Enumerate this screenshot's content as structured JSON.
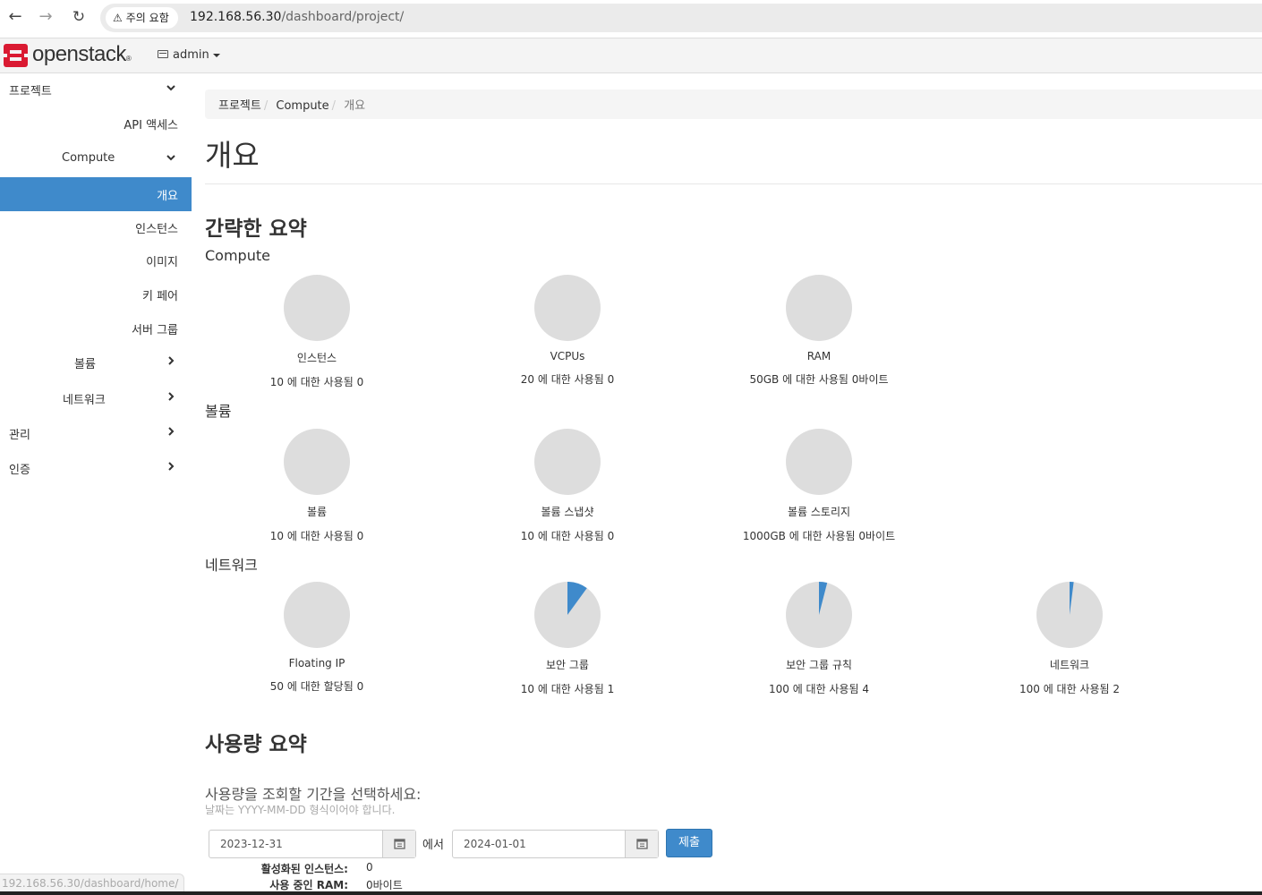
{
  "browser": {
    "security_label": "주의 요함",
    "url_host": "192.168.56.30",
    "url_path": "/dashboard/project/",
    "status_url": "192.168.56.30/dashboard/home/"
  },
  "header": {
    "brand": "openstack",
    "brand_mark": "®",
    "project": "admin"
  },
  "sidebar": {
    "items": [
      {
        "label": "프로젝트",
        "chevron": "down"
      },
      {
        "label": "API 액세스"
      },
      {
        "label": "Compute",
        "chevron": "down"
      },
      {
        "label": "개요",
        "active": true
      },
      {
        "label": "인스턴스"
      },
      {
        "label": "이미지"
      },
      {
        "label": "키 페어"
      },
      {
        "label": "서버 그룹"
      },
      {
        "label": "볼륨",
        "chevron": "right"
      },
      {
        "label": "네트워크",
        "chevron": "right"
      },
      {
        "label": "관리",
        "chevron": "right"
      },
      {
        "label": "인증",
        "chevron": "right"
      }
    ]
  },
  "breadcrumb": [
    "프로젝트",
    "Compute",
    "개요"
  ],
  "page_title": "개요",
  "overview": {
    "heading": "간략한 요약",
    "groups": [
      {
        "label": "Compute",
        "charts": [
          {
            "title": "인스턴스",
            "subtitle": "10 에 대한 사용됨 0",
            "used": 0,
            "total": 10
          },
          {
            "title": "VCPUs",
            "subtitle": "20 에 대한 사용됨 0",
            "used": 0,
            "total": 20
          },
          {
            "title": "RAM",
            "subtitle": "50GB 에 대한 사용됨 0바이트",
            "used": 0,
            "total": 50
          }
        ]
      },
      {
        "label": "볼륨",
        "charts": [
          {
            "title": "볼륨",
            "subtitle": "10 에 대한 사용됨 0",
            "used": 0,
            "total": 10
          },
          {
            "title": "볼륨 스냅샷",
            "subtitle": "10 에 대한 사용됨 0",
            "used": 0,
            "total": 10
          },
          {
            "title": "볼륨 스토리지",
            "subtitle": "1000GB 에 대한 사용됨 0바이트",
            "used": 0,
            "total": 1000
          }
        ]
      },
      {
        "label": "네트워크",
        "charts": [
          {
            "title": "Floating IP",
            "subtitle": "50 에 대한 할당됨 0",
            "used": 0,
            "total": 50
          },
          {
            "title": "보안 그룹",
            "subtitle": "10 에 대한 사용됨 1",
            "used": 1,
            "total": 10
          },
          {
            "title": "보안 그룹 규칙",
            "subtitle": "100 에 대한 사용됨 4",
            "used": 4,
            "total": 100
          },
          {
            "title": "네트워크",
            "subtitle": "100 에 대한 사용됨 2",
            "used": 2,
            "total": 100
          }
        ]
      }
    ]
  },
  "usage": {
    "heading": "사용량 요약",
    "prompt": "사용량을 조회할 기간을 선택하세요:",
    "hint": "날짜는 YYYY-MM-DD 형식이어야 합니다.",
    "start_date": "2023-12-31",
    "from_label": "에서",
    "end_date": "2024-01-01",
    "submit": "제출",
    "summary": [
      {
        "label": "활성화된 인스턴스:",
        "value": "0"
      },
      {
        "label": "사용 중인 RAM:",
        "value": "0바이트"
      }
    ]
  },
  "colors": {
    "accent": "#3f8acb",
    "pie_empty": "#dddddd",
    "logo_red": "#da1a32"
  }
}
